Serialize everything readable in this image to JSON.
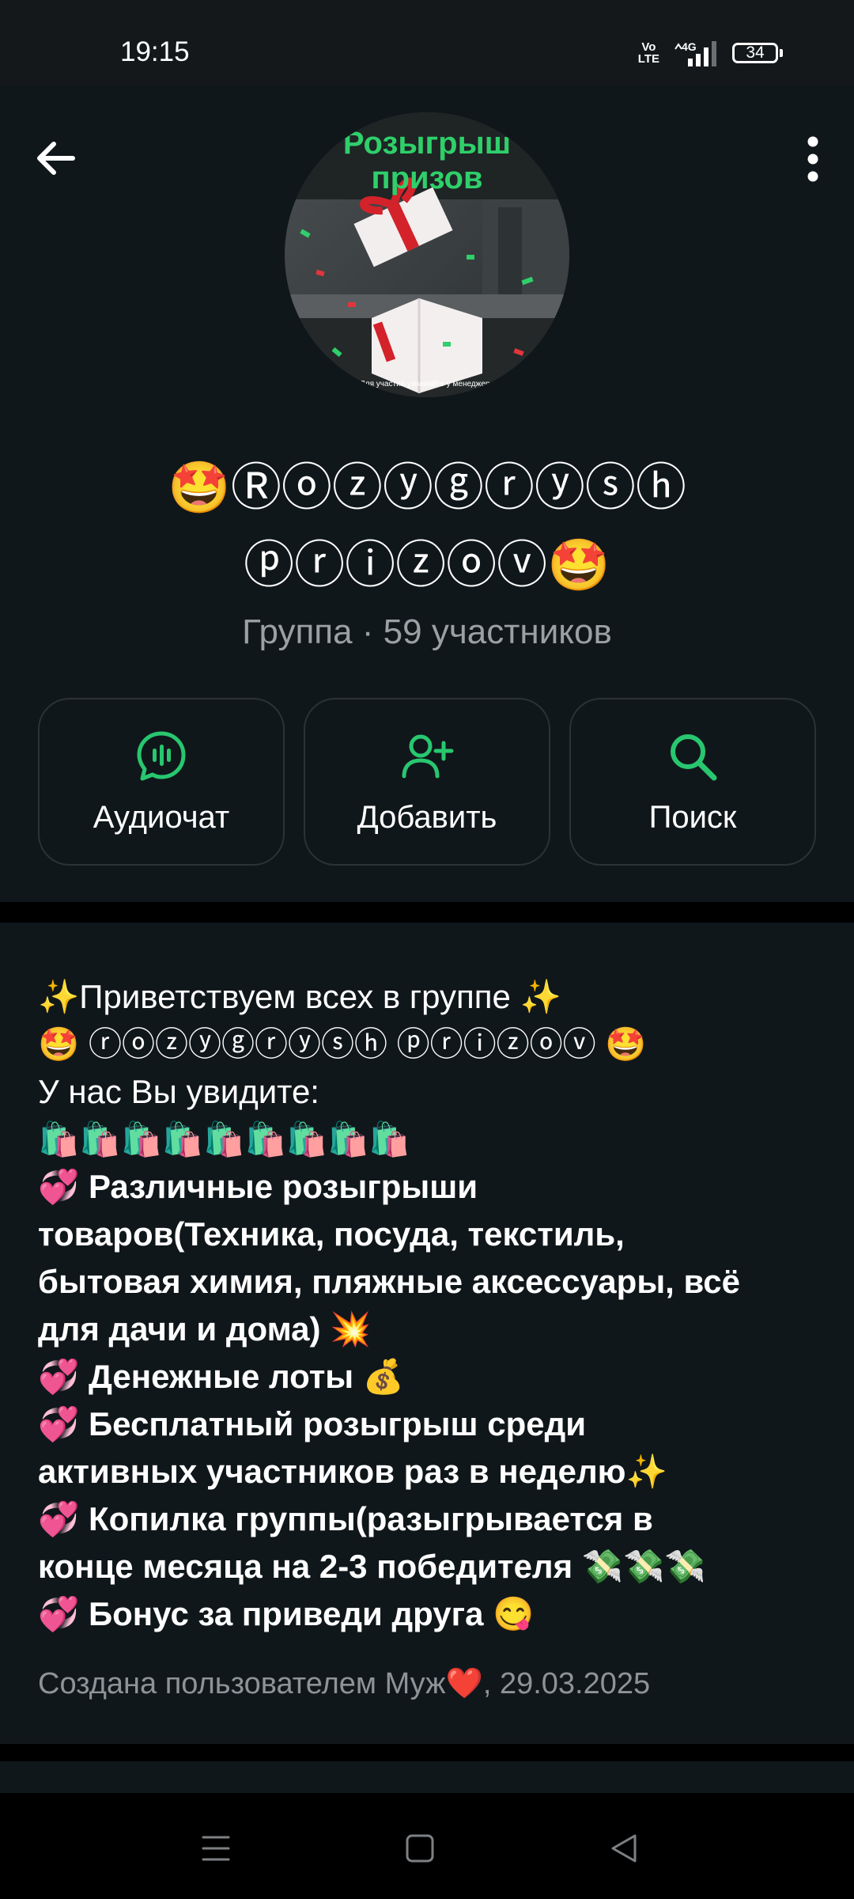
{
  "status": {
    "time": "19:15",
    "volte": "Vo\nLTE",
    "network": "4G",
    "battery": "34"
  },
  "header": {
    "avatar_text_line1": "Розыгрыш",
    "avatar_text_line2": "призов",
    "avatar_caption": "Для участия узнавайте у менеджера",
    "title_line1": "🤩Ⓡⓞⓩⓨⓖⓡⓨⓢⓗ",
    "title_line2": "ⓟⓡⓘⓩⓞⓥ🤩",
    "meta": "Группа · 59 участников"
  },
  "actions": [
    {
      "label": "Аудиочат",
      "icon": "audiochat-icon"
    },
    {
      "label": "Добавить",
      "icon": "add-user-icon"
    },
    {
      "label": "Поиск",
      "icon": "search-icon"
    }
  ],
  "description": {
    "lines": [
      "✨Приветствуем всех в группе ✨",
      "🤩 ⓡⓞⓩⓨⓖⓡⓨⓢⓗ ⓟⓡⓘⓩⓞⓥ 🤩",
      "У нас Вы увидите:",
      "🛍️🛍️🛍️🛍️🛍️🛍️🛍️🛍️🛍️",
      "💞 Различные розыгрыши",
      "товаров(Техника, посуда, текстиль,",
      "бытовая химия, пляжные аксессуары, всё",
      "для дачи и дома) 💥",
      "💞 Денежные лоты 💰",
      "💞 Бесплатный розыгрыш среди",
      "активных участников раз в неделю✨",
      "💞 Копилка группы(разыгрывается в",
      "конце месяца на 2-3 победителя 💸💸💸",
      "💞 Бонус за приведи друга 😋"
    ],
    "created": "Создана пользователем Муж❤️, 29.03.2025"
  },
  "colors": {
    "accent": "#28c76f",
    "panel": "#10171b",
    "muted": "#9aa0a4"
  }
}
